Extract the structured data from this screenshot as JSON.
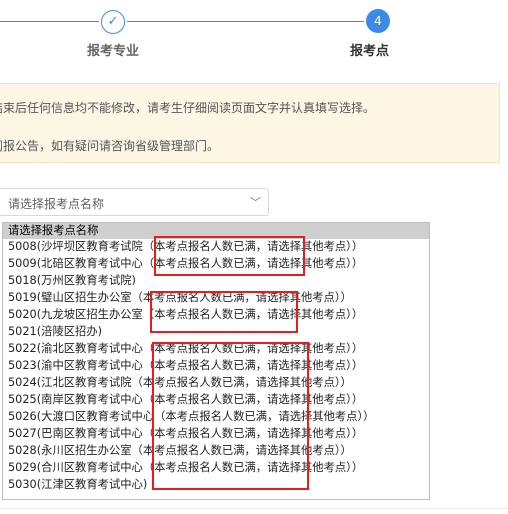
{
  "stepper": {
    "done_mark": "✓",
    "step3_label": "报考专业",
    "step4_number": "4",
    "step4_label": "报考点"
  },
  "notice": {
    "line1": "结束后任何信息均不能修改，请考生仔细阅读页面文字并认真填写选择。",
    "line2": "阅报公告，如有疑问请咨询省级管理部门。"
  },
  "select": {
    "value": "请选择报考点名称"
  },
  "options": [
    "请选择报考点名称",
    "5008(沙坪坝区教育考试院（本考点报名人数已满，请选择其他考点））",
    "5009(北碚区教育考试中心（本考点报名人数已满，请选择其他考点））",
    "5018(万州区教育考试院)",
    "5019(璧山区招生办公室（本考点报名人数已满，请选择其他考点））",
    "5020(九龙坡区招生办公室（本考点报名人数已满，请选择其他考点））",
    "5021(涪陵区招办)",
    "5022(渝北区教育考试中心（本考点报名人数已满，请选择其他考点））",
    "5023(渝中区教育考试中心（本考点报名人数已满，请选择其他考点））",
    "5024(江北区教育考试院（本考点报名人数已满，请选择其他考点））",
    "5025(南岸区教育考试中心（本考点报名人数已满，请选择其他考点））",
    "5026(大渡口区教育考试中心（本考点报名人数已满，请选择其他考点））",
    "5027(巴南区教育考试中心（本考点报名人数已满，请选择其他考点））",
    "5028(永川区招生办公室（本考点报名人数已满，请选择其他考点））",
    "5029(合川区教育考试中心（本考点报名人数已满，请选择其他考点））",
    "5030(江津区教育考试中心)"
  ],
  "colors": {
    "accent": "#3a8be8",
    "annotation": "#e02020",
    "notice_bg": "#fdf6e4"
  }
}
